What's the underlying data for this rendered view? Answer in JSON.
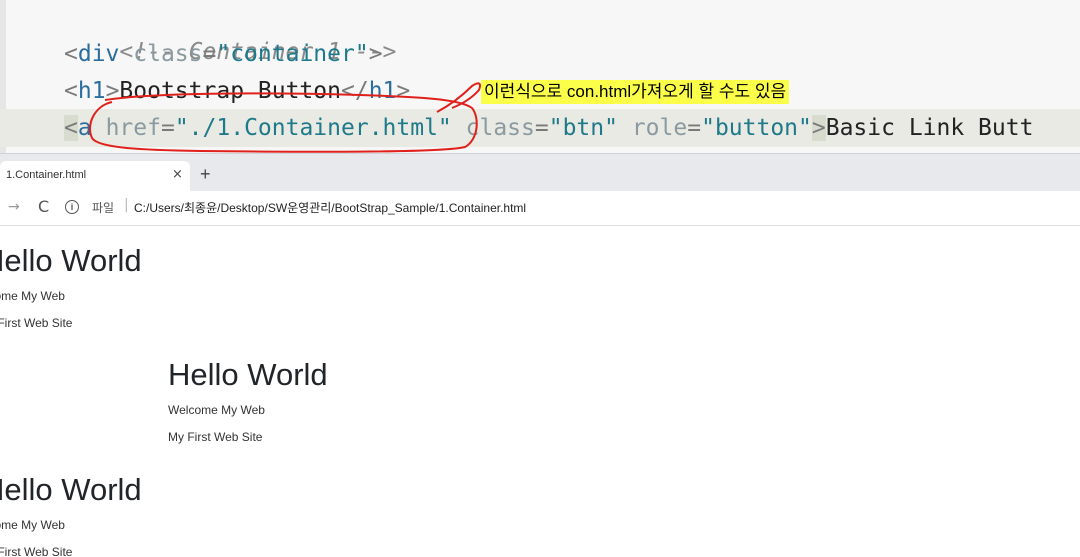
{
  "editor": {
    "line1_comment": "<!-- Container 1 -->",
    "line2": {
      "open": "<",
      "tag": "div",
      "attr": " class",
      "eq": "=",
      "value": "\"container\"",
      "close": ">"
    },
    "line3": {
      "open": "<",
      "tag": "h1",
      "close1": ">",
      "text": "Bootstrap Button",
      "end_open": "</",
      "end_tag": "h1",
      "close2": ">"
    },
    "line4": {
      "open": "<",
      "tag": "a",
      "attr1": " href",
      "eq1": "=",
      "value1": "\"./1.Container.html\"",
      "attr2": " class",
      "eq2": "=",
      "value2": "\"btn\"",
      "attr3": " role",
      "eq3": "=",
      "value3": "\"button\"",
      "close": ">",
      "text": "Basic Link Butt"
    },
    "annotation_note": "이런식으로 con.html가져오게 할 수도 있음",
    "annotation_color": "#e0201b",
    "highlight_color": "#fcff4a"
  },
  "browser": {
    "tab_title": "1.Container.html",
    "tab_close": "×",
    "new_tab": "+",
    "forward_glyph": "→",
    "reload_glyph": "C",
    "info_glyph": "i",
    "url_scheme_label": "파일",
    "url_separator": "|",
    "url": "C:/Users/최종윤/Desktop/SW운영관리/BootStrap_Sample/1.Container.html"
  },
  "page": {
    "blocks": [
      {
        "heading": "Hello World",
        "line1": "Welcome My Web",
        "line2": "My First Web Site"
      },
      {
        "heading": "Hello World",
        "line1": "Welcome My Web",
        "line2": "My First Web Site"
      },
      {
        "heading": "Hello World",
        "line1": "Welcome My Web",
        "line2": "My First Web Site"
      }
    ]
  }
}
